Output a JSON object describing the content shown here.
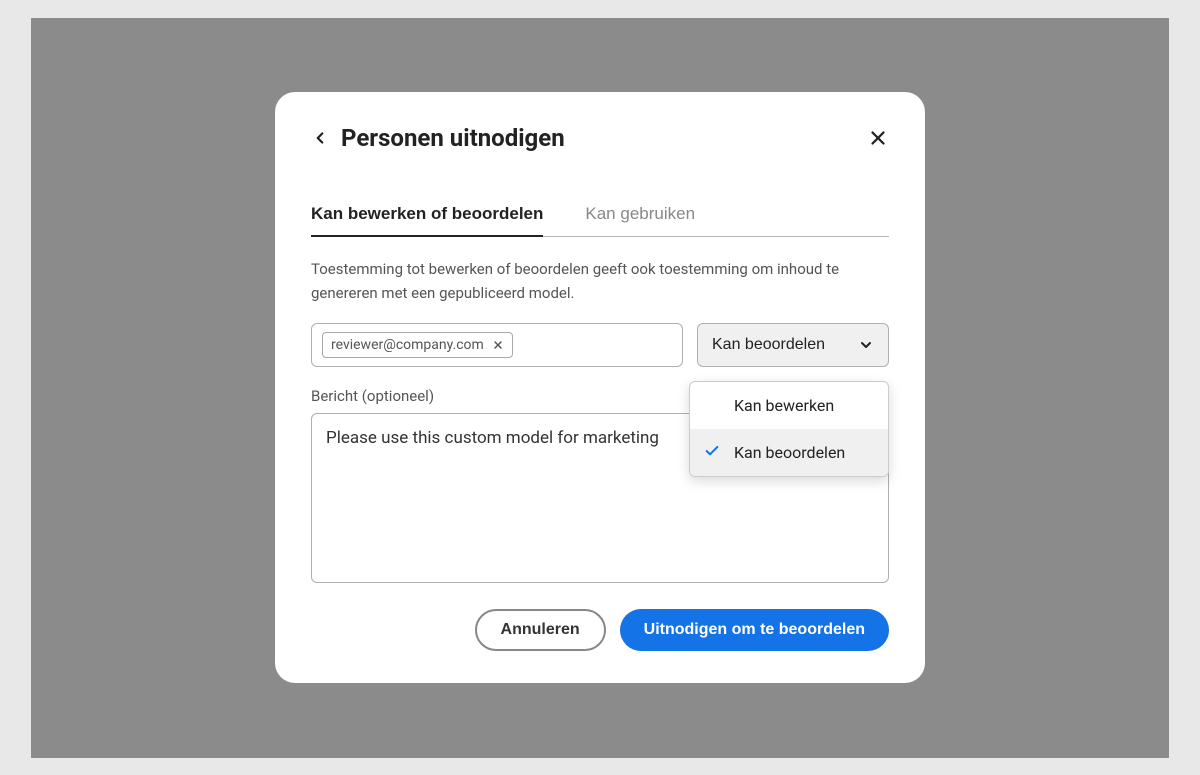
{
  "dialog": {
    "title": "Personen uitnodigen",
    "tabs": {
      "edit_review": "Kan bewerken of beoordelen",
      "use": "Kan gebruiken"
    },
    "description": "Toestemming tot bewerken of beoordelen geeft ook toestemming om inhoud te genereren met een gepubliceerd model.",
    "email_chip": "reviewer@company.com",
    "role_select": {
      "selected": "Kan beoordelen",
      "options": {
        "edit": "Kan bewerken",
        "review": "Kan beoordelen"
      }
    },
    "message": {
      "label": "Bericht (optioneel)",
      "value": "Please use this custom model for marketing"
    },
    "buttons": {
      "cancel": "Annuleren",
      "primary": "Uitnodigen om te beoordelen"
    }
  }
}
